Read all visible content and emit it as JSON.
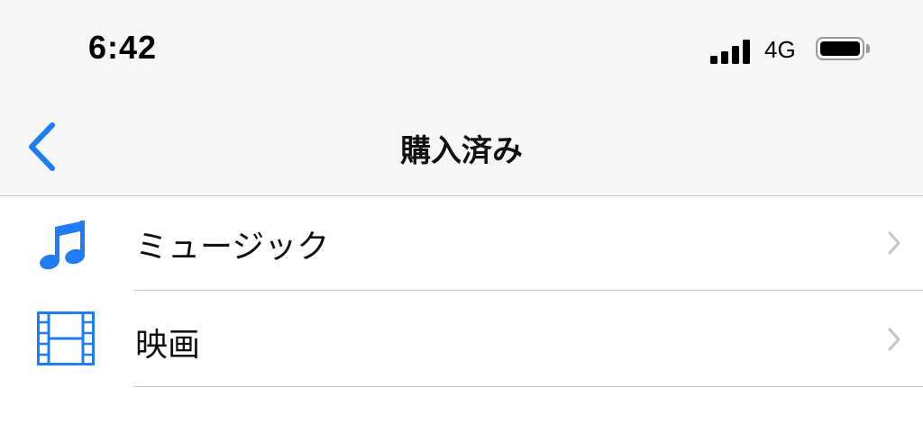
{
  "status_bar": {
    "time": "6:42",
    "network": "4G",
    "signal_icon": "cellular-signal-icon",
    "battery_icon": "battery-full-icon"
  },
  "nav": {
    "back_icon": "chevron-left-icon",
    "title": "購入済み"
  },
  "list": {
    "items": [
      {
        "label": "ミュージック",
        "icon": "music-note-icon"
      },
      {
        "label": "映画",
        "icon": "film-strip-icon"
      }
    ]
  },
  "colors": {
    "accent": "#1f7cf4",
    "nav_background": "#f6f6f6",
    "chevron": "#c4c4c7",
    "separator": "#c8c8cc"
  }
}
